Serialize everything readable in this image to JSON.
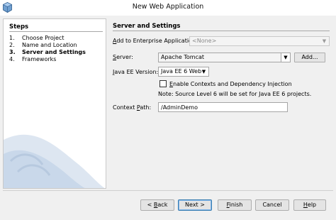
{
  "window": {
    "title": "New Web Application"
  },
  "steps": {
    "heading": "Steps",
    "items": [
      {
        "num": "1.",
        "label": "Choose Project",
        "current": false
      },
      {
        "num": "2.",
        "label": "Name and Location",
        "current": false
      },
      {
        "num": "3.",
        "label": "Server and Settings",
        "current": true
      },
      {
        "num": "4.",
        "label": "Frameworks",
        "current": false
      }
    ]
  },
  "content": {
    "heading": "Server and Settings",
    "enterprise": {
      "label_prefix": "A",
      "label_rest": "dd to Enterprise Application:",
      "value": "<None>"
    },
    "server": {
      "label_prefix": "S",
      "label_rest": "erver:",
      "value": "Apache Tomcat",
      "add_button": "Add..."
    },
    "java_ee": {
      "label_prefix": "J",
      "label_rest": "ava EE Version:",
      "value": "Java EE 6 Web"
    },
    "cdi": {
      "label_prefix": "E",
      "label_rest": "nable Contexts and Dependency Injection",
      "checked": false
    },
    "note": "Note: Source Level 6 will be set for Java EE 6 projects.",
    "context_path": {
      "label_prefix": "Context ",
      "label_underlined": "P",
      "label_rest": "ath:",
      "value": "/AdminDemo"
    }
  },
  "buttons": {
    "back_prefix": "< ",
    "back_underlined": "B",
    "back_rest": "ack",
    "next": "Next >",
    "finish_underlined": "F",
    "finish_rest": "inish",
    "cancel": "Cancel",
    "help_underlined": "H",
    "help_rest": "elp"
  },
  "colors": {
    "frame": "#f0f0f0",
    "panel_border": "#c9c9c9",
    "default_button_border": "#3c7fb1"
  },
  "icons": {
    "app": "netbeans-cube-icon",
    "combo_arrow": "chevron-down-icon"
  }
}
